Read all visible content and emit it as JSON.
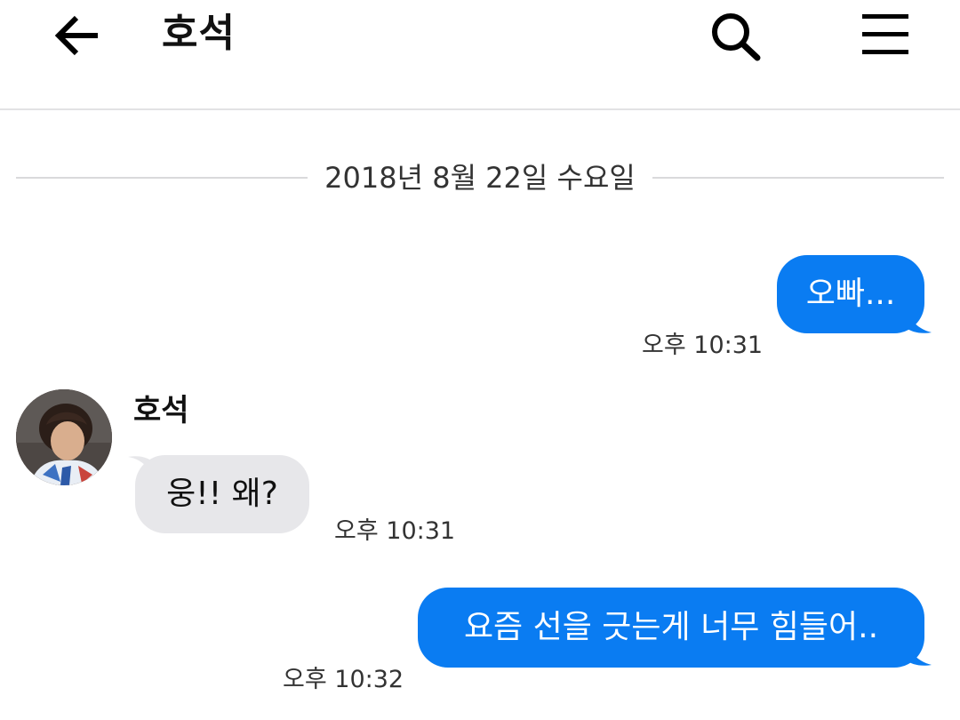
{
  "header": {
    "title": "호석",
    "back_icon": "arrow-left-icon",
    "search_icon": "search-icon",
    "menu_icon": "hamburger-menu-icon"
  },
  "date_divider": "2018년 8월 22일 수요일",
  "messages": [
    {
      "direction": "outgoing",
      "text": "오빠...",
      "time": "오후 10:31"
    },
    {
      "direction": "incoming",
      "sender": "호석",
      "text": "웅!! 왜?",
      "time": "오후 10:31"
    },
    {
      "direction": "outgoing",
      "text": "요즘 선을 긋는게 너무 힘들어..",
      "time": "오후 10:32"
    }
  ],
  "colors": {
    "outgoing_bubble": "#0a7cf2",
    "incoming_bubble": "#e7e7ea",
    "divider": "#d9d9db"
  }
}
